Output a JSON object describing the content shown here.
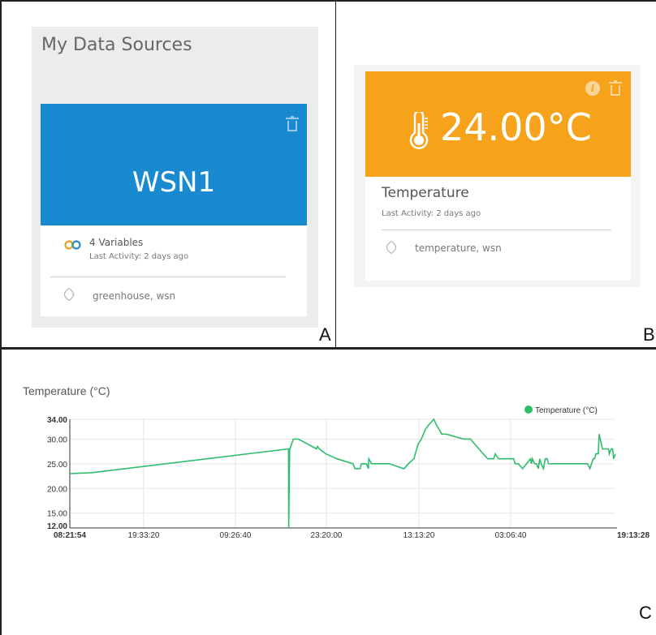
{
  "panel_a": {
    "label": "A",
    "title": "My Data Sources",
    "card": {
      "name": "WSN1",
      "variables": "4 Variables",
      "last_activity": "Last Activity: 2 days ago",
      "tags": "greenhouse,  wsn"
    }
  },
  "panel_b": {
    "label": "B",
    "card": {
      "value": "24.00°C",
      "name": "Temperature",
      "last_activity": "Last Activity: 2 days ago",
      "tags": "temperature,  wsn"
    }
  },
  "panel_c": {
    "label": "C",
    "title": "Temperature (°C)",
    "legend": "Temperature (°C)"
  },
  "colors": {
    "datasource_header": "#1a8ad0",
    "variable_header": "#f7a21b",
    "line": "#2ebd6b"
  },
  "chart_data": {
    "type": "line",
    "title": "Temperature (°C)",
    "xlabel": "",
    "ylabel": "",
    "ylim": [
      12,
      34
    ],
    "y_ticks": [
      "34.00",
      "30.00",
      "25.00",
      "20.00",
      "15.00",
      "12.00"
    ],
    "x_ticks": [
      "08:21:54",
      "19:33:20",
      "09:26:40",
      "23:20:00",
      "13:13:20",
      "03:06:40",
      "19:13:28"
    ],
    "x_ticks_bold": [
      true,
      false,
      false,
      false,
      false,
      false,
      true
    ],
    "legend_position": "top-right",
    "grid": true,
    "series": [
      {
        "name": "Temperature (°C)",
        "x": [
          0,
          0.0322,
          0.3159,
          0.3161,
          0.3175,
          0.3181,
          0.3228,
          0.3302,
          0.3563,
          0.3576,
          0.3603,
          0.3697,
          0.3858,
          0.4091,
          0.4118,
          0.4192,
          0.4211,
          0.4285,
          0.4312,
          0.4319,
          0.4359,
          0.4614,
          0.4822,
          0.4829,
          0.4889,
          0.497,
          0.503,
          0.5077,
          0.5137,
          0.5191,
          0.5258,
          0.5291,
          0.5372,
          0.5439,
          0.5687,
          0.5787,
          0.5908,
          0.6036,
          0.6056,
          0.6123,
          0.6143,
          0.6191,
          0.6345,
          0.6412,
          0.6432,
          0.6445,
          0.6479,
          0.6539,
          0.6653,
          0.6667,
          0.668,
          0.6713,
          0.674,
          0.6767,
          0.6787,
          0.6807,
          0.6841,
          0.6867,
          0.6894,
          0.6914,
          0.6948,
          0.7055,
          0.733,
          0.7411,
          0.7478,
          0.7512,
          0.7559,
          0.7579,
          0.7599,
          0.7633,
          0.7646,
          0.7693,
          0.7726,
          0.778,
          0.7792,
          0.782,
          0.784,
          0.7854,
          0.788
        ],
        "y": [
          23,
          23.2,
          28,
          12,
          28,
          28.1,
          30,
          30,
          28,
          28.5,
          28,
          27,
          26,
          25,
          24,
          24,
          25,
          25,
          24,
          26,
          25,
          25,
          24,
          24,
          25,
          26,
          29,
          30,
          32,
          33,
          34,
          33,
          31,
          31,
          30,
          30,
          28,
          26,
          26,
          26,
          27,
          26,
          26,
          26,
          25,
          25,
          25,
          24,
          26,
          25,
          26,
          25,
          25,
          24,
          26,
          25,
          24,
          26,
          26,
          25,
          25,
          25,
          25,
          25,
          25,
          24,
          26,
          26,
          27,
          27,
          31,
          28,
          28,
          28,
          27,
          28,
          28,
          26,
          27
        ]
      }
    ]
  }
}
